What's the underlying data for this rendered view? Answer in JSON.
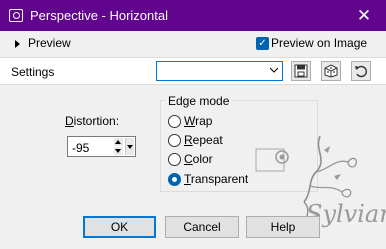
{
  "window": {
    "title": "Perspective - Horizontal",
    "close_glyph": "✕",
    "icons": {
      "app": "perspective-app-icon",
      "close": "close-icon"
    }
  },
  "preview_row": {
    "label": "Preview",
    "preview_on_image_label": "Preview on Image",
    "preview_on_image_checked": true
  },
  "settings": {
    "label": "Settings",
    "preset_value": "",
    "tool_icons": [
      "save-preset-icon",
      "random-dice-icon",
      "reset-icon"
    ]
  },
  "distortion": {
    "label_accesskey": "D",
    "label_rest": "istortion:",
    "value": "-95"
  },
  "edge_mode": {
    "legend": "Edge mode",
    "options": [
      {
        "accesskey": "W",
        "rest": "rap",
        "selected": false
      },
      {
        "accesskey": "R",
        "rest": "epeat",
        "selected": false
      },
      {
        "accesskey": "C",
        "rest": "olor",
        "selected": false
      },
      {
        "accesskey": "T",
        "rest": "ransparent",
        "selected": true
      }
    ]
  },
  "buttons": {
    "ok": "OK",
    "cancel": "Cancel",
    "help": "Help"
  },
  "watermark_text": "Sylviane",
  "colors": {
    "titlebar": "#61058f",
    "accent": "#0078d7",
    "check_fill": "#0063b1",
    "dialog_bg": "#f0f0f0"
  }
}
